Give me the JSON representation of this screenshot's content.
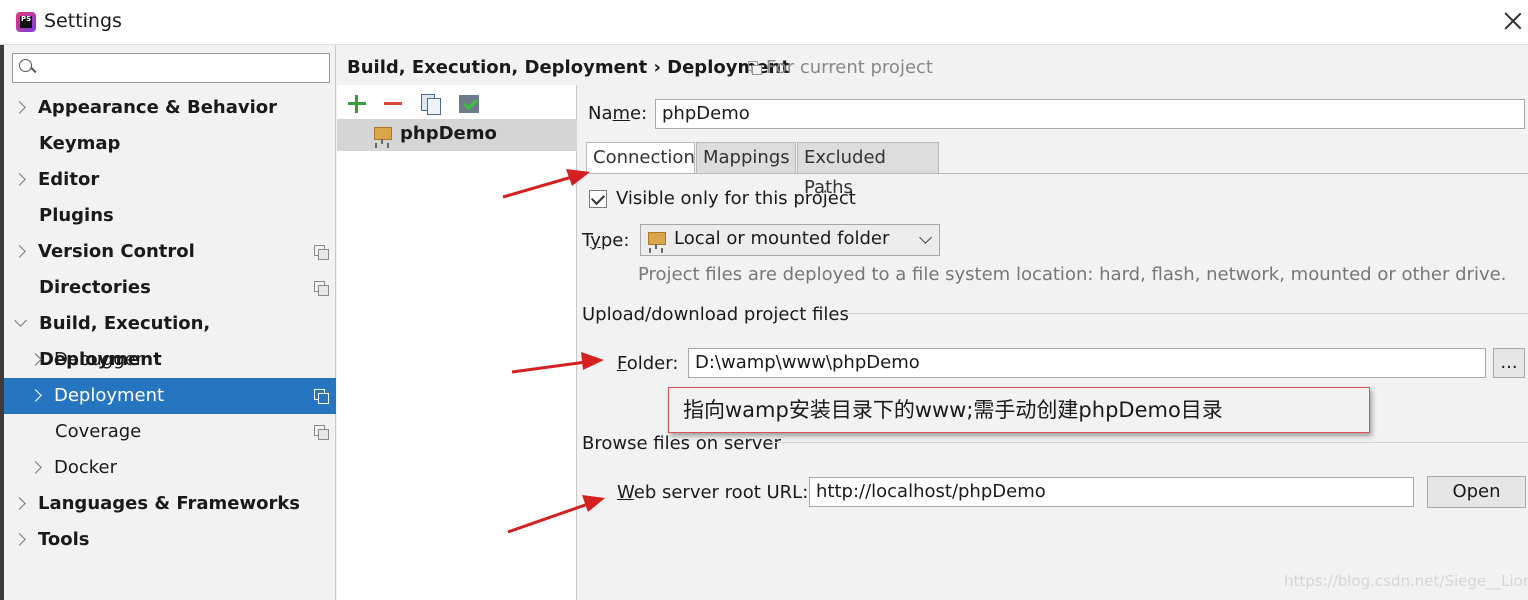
{
  "window": {
    "title": "Settings"
  },
  "search": {
    "placeholder": ""
  },
  "sidebar": {
    "items": [
      {
        "label": "Appearance & Behavior"
      },
      {
        "label": "Keymap"
      },
      {
        "label": "Editor"
      },
      {
        "label": "Plugins"
      },
      {
        "label": "Version Control"
      },
      {
        "label": "Directories"
      },
      {
        "label": "Build, Execution, Deployment"
      },
      {
        "label": "Debugger"
      },
      {
        "label": "Deployment"
      },
      {
        "label": "Coverage"
      },
      {
        "label": "Docker"
      },
      {
        "label": "Languages & Frameworks"
      },
      {
        "label": "Tools"
      }
    ]
  },
  "header": {
    "breadcrumb": "Build, Execution, Deployment › Deployment",
    "scope": "For current project"
  },
  "servers": {
    "items": [
      {
        "name": "phpDemo"
      }
    ]
  },
  "form": {
    "name_label_prefix": "Na",
    "name_label_mnemonic": "m",
    "name_label_suffix": "e:",
    "name_value": "phpDemo",
    "tabs": [
      "Connection",
      "Mappings",
      "Excluded Paths"
    ],
    "visible_only_label": "Visible only for this project",
    "type_label_prefix": "T",
    "type_label_mnemonic": "y",
    "type_label_suffix": "pe:",
    "type_value": "Local or mounted folder",
    "type_hint": "Project files are deployed to a file system location: hard, flash, network, mounted or other drive.",
    "upload_section": "Upload/download project files",
    "folder_label_mnemonic": "F",
    "folder_label_suffix": "older:",
    "folder_value": "D:\\wamp\\www\\phpDemo",
    "browse_button": "...",
    "browse_section": "Browse files on server",
    "web_url_label_mnemonic": "W",
    "web_url_label_suffix": "eb server root URL:",
    "web_url_value": "http://localhost/phpDemo",
    "open_button": "Open"
  },
  "annotation": {
    "text": "指向wamp安装目录下的www;需手动创建phpDemo目录"
  },
  "watermark": "https://blog.csdn.net/Siege__Lion",
  "colors": {
    "selection": "#2675c0",
    "annotation_border": "#d9534f",
    "arrow": "#d42020"
  }
}
